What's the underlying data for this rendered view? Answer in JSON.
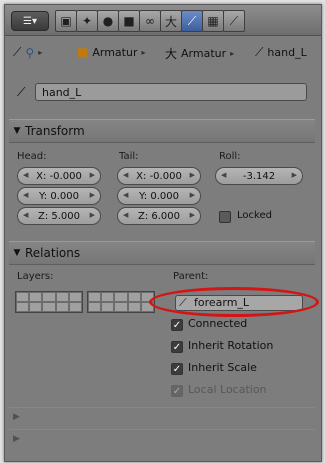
{
  "header": {
    "editor_type_icon": "properties-editor-icon",
    "context_tabs": [
      {
        "icon": "render-icon",
        "active": false
      },
      {
        "icon": "scene-icon",
        "active": false
      },
      {
        "icon": "world-icon",
        "active": false
      },
      {
        "icon": "object-icon",
        "active": false
      },
      {
        "icon": "constraint-icon",
        "active": false
      },
      {
        "icon": "armature-icon",
        "active": false
      },
      {
        "icon": "bone-icon",
        "active": true
      },
      {
        "icon": "bone-constraint-icon",
        "active": false
      },
      {
        "icon": "texture-icon",
        "active": false
      }
    ]
  },
  "breadcrumb": {
    "items": [
      "Armatur",
      "Armatur",
      "hand_L"
    ]
  },
  "bone_name": "hand_L",
  "transform": {
    "title": "Transform",
    "head_label": "Head:",
    "tail_label": "Tail:",
    "roll_label": "Roll:",
    "head": {
      "x": "X: -0.000",
      "y": "Y: 0.000",
      "z": "Z: 5.000"
    },
    "tail": {
      "x": "X: -0.000",
      "y": "Y: 0.000",
      "z": "Z: 6.000"
    },
    "roll": "-3.142",
    "locked_label": "Locked",
    "locked": false
  },
  "relations": {
    "title": "Relations",
    "layers_label": "Layers:",
    "parent_label": "Parent:",
    "parent_value": "forearm_L",
    "connected_label": "Connected",
    "connected": true,
    "inherit_rotation_label": "Inherit Rotation",
    "inherit_rotation": true,
    "inherit_scale_label": "Inherit Scale",
    "inherit_scale": true,
    "local_location_label": "Local Location",
    "local_location": true
  },
  "highlight_color": "#d41515",
  "accent_color": "#4a6fb0"
}
